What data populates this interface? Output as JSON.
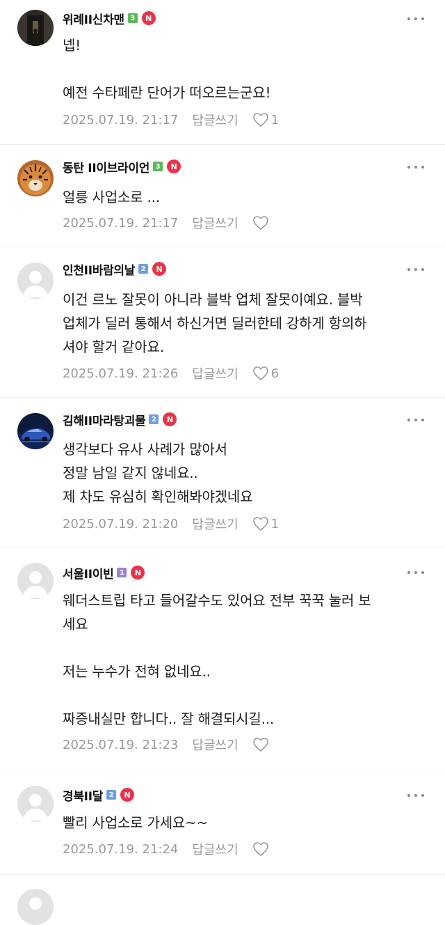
{
  "colors": {
    "level_green": "#5cb85c",
    "level_blue": "#6c9ee8",
    "level_purple": "#9c7fd6",
    "n_badge_red": "#e8334a",
    "meta_gray": "#9a9a9a"
  },
  "comments": [
    {
      "nickname": "위례II신차맨",
      "level": "3",
      "level_color": "green",
      "badge": "N",
      "avatar": "photo-night-alley",
      "lines": [
        "넵!",
        "",
        "예전 수타페란 단어가 떠오르는군요!"
      ],
      "timestamp": "2025.07.19. 21:17",
      "reply_label": "답글쓰기",
      "like_count": "1"
    },
    {
      "nickname": "동탄 II이브라이언",
      "level": "3",
      "level_color": "green",
      "badge": "N",
      "avatar": "photo-tiger",
      "lines": [
        "얼릉 사업소로 ..."
      ],
      "timestamp": "2025.07.19. 21:17",
      "reply_label": "답글쓰기",
      "like_count": ""
    },
    {
      "nickname": "인천II바람의날",
      "level": "2",
      "level_color": "blue",
      "badge": "N",
      "avatar": "default-person",
      "lines": [
        "이건 르노 잘못이 아니라 블박 업체 잘못이예요. 블박",
        "업체가 딜러 통해서 하신거면 딜러한테 강하게 항의하",
        "셔야 할거 같아요."
      ],
      "timestamp": "2025.07.19. 21:26",
      "reply_label": "답글쓰기",
      "like_count": "6"
    },
    {
      "nickname": "김해II마라탕괴물",
      "level": "2",
      "level_color": "blue",
      "badge": "N",
      "avatar": "photo-blue-car",
      "lines": [
        "생각보다 유사 사례가 많아서",
        "정말 남일 같지 않네요..",
        "제 차도 유심히 확인해봐야겠네요"
      ],
      "timestamp": "2025.07.19. 21:20",
      "reply_label": "답글쓰기",
      "like_count": "1"
    },
    {
      "nickname": "서울II이빈",
      "level": "1",
      "level_color": "purple",
      "badge": "N",
      "avatar": "default-person",
      "lines": [
        "웨더스트립 타고 들어갈수도 있어요 전부 꾹꾹 눌러 보",
        "세요",
        "",
        "저는 누수가 전혀 없네요..",
        "",
        "짜증내실만 합니다.. 잘 해결되시길..."
      ],
      "timestamp": "2025.07.19. 21:23",
      "reply_label": "답글쓰기",
      "like_count": ""
    },
    {
      "nickname": "경북II달",
      "level": "2",
      "level_color": "blue",
      "badge": "N",
      "avatar": "default-person",
      "lines": [
        "빨리 사업소로 가세요~~"
      ],
      "timestamp": "2025.07.19. 21:24",
      "reply_label": "답글쓰기",
      "like_count": ""
    }
  ]
}
